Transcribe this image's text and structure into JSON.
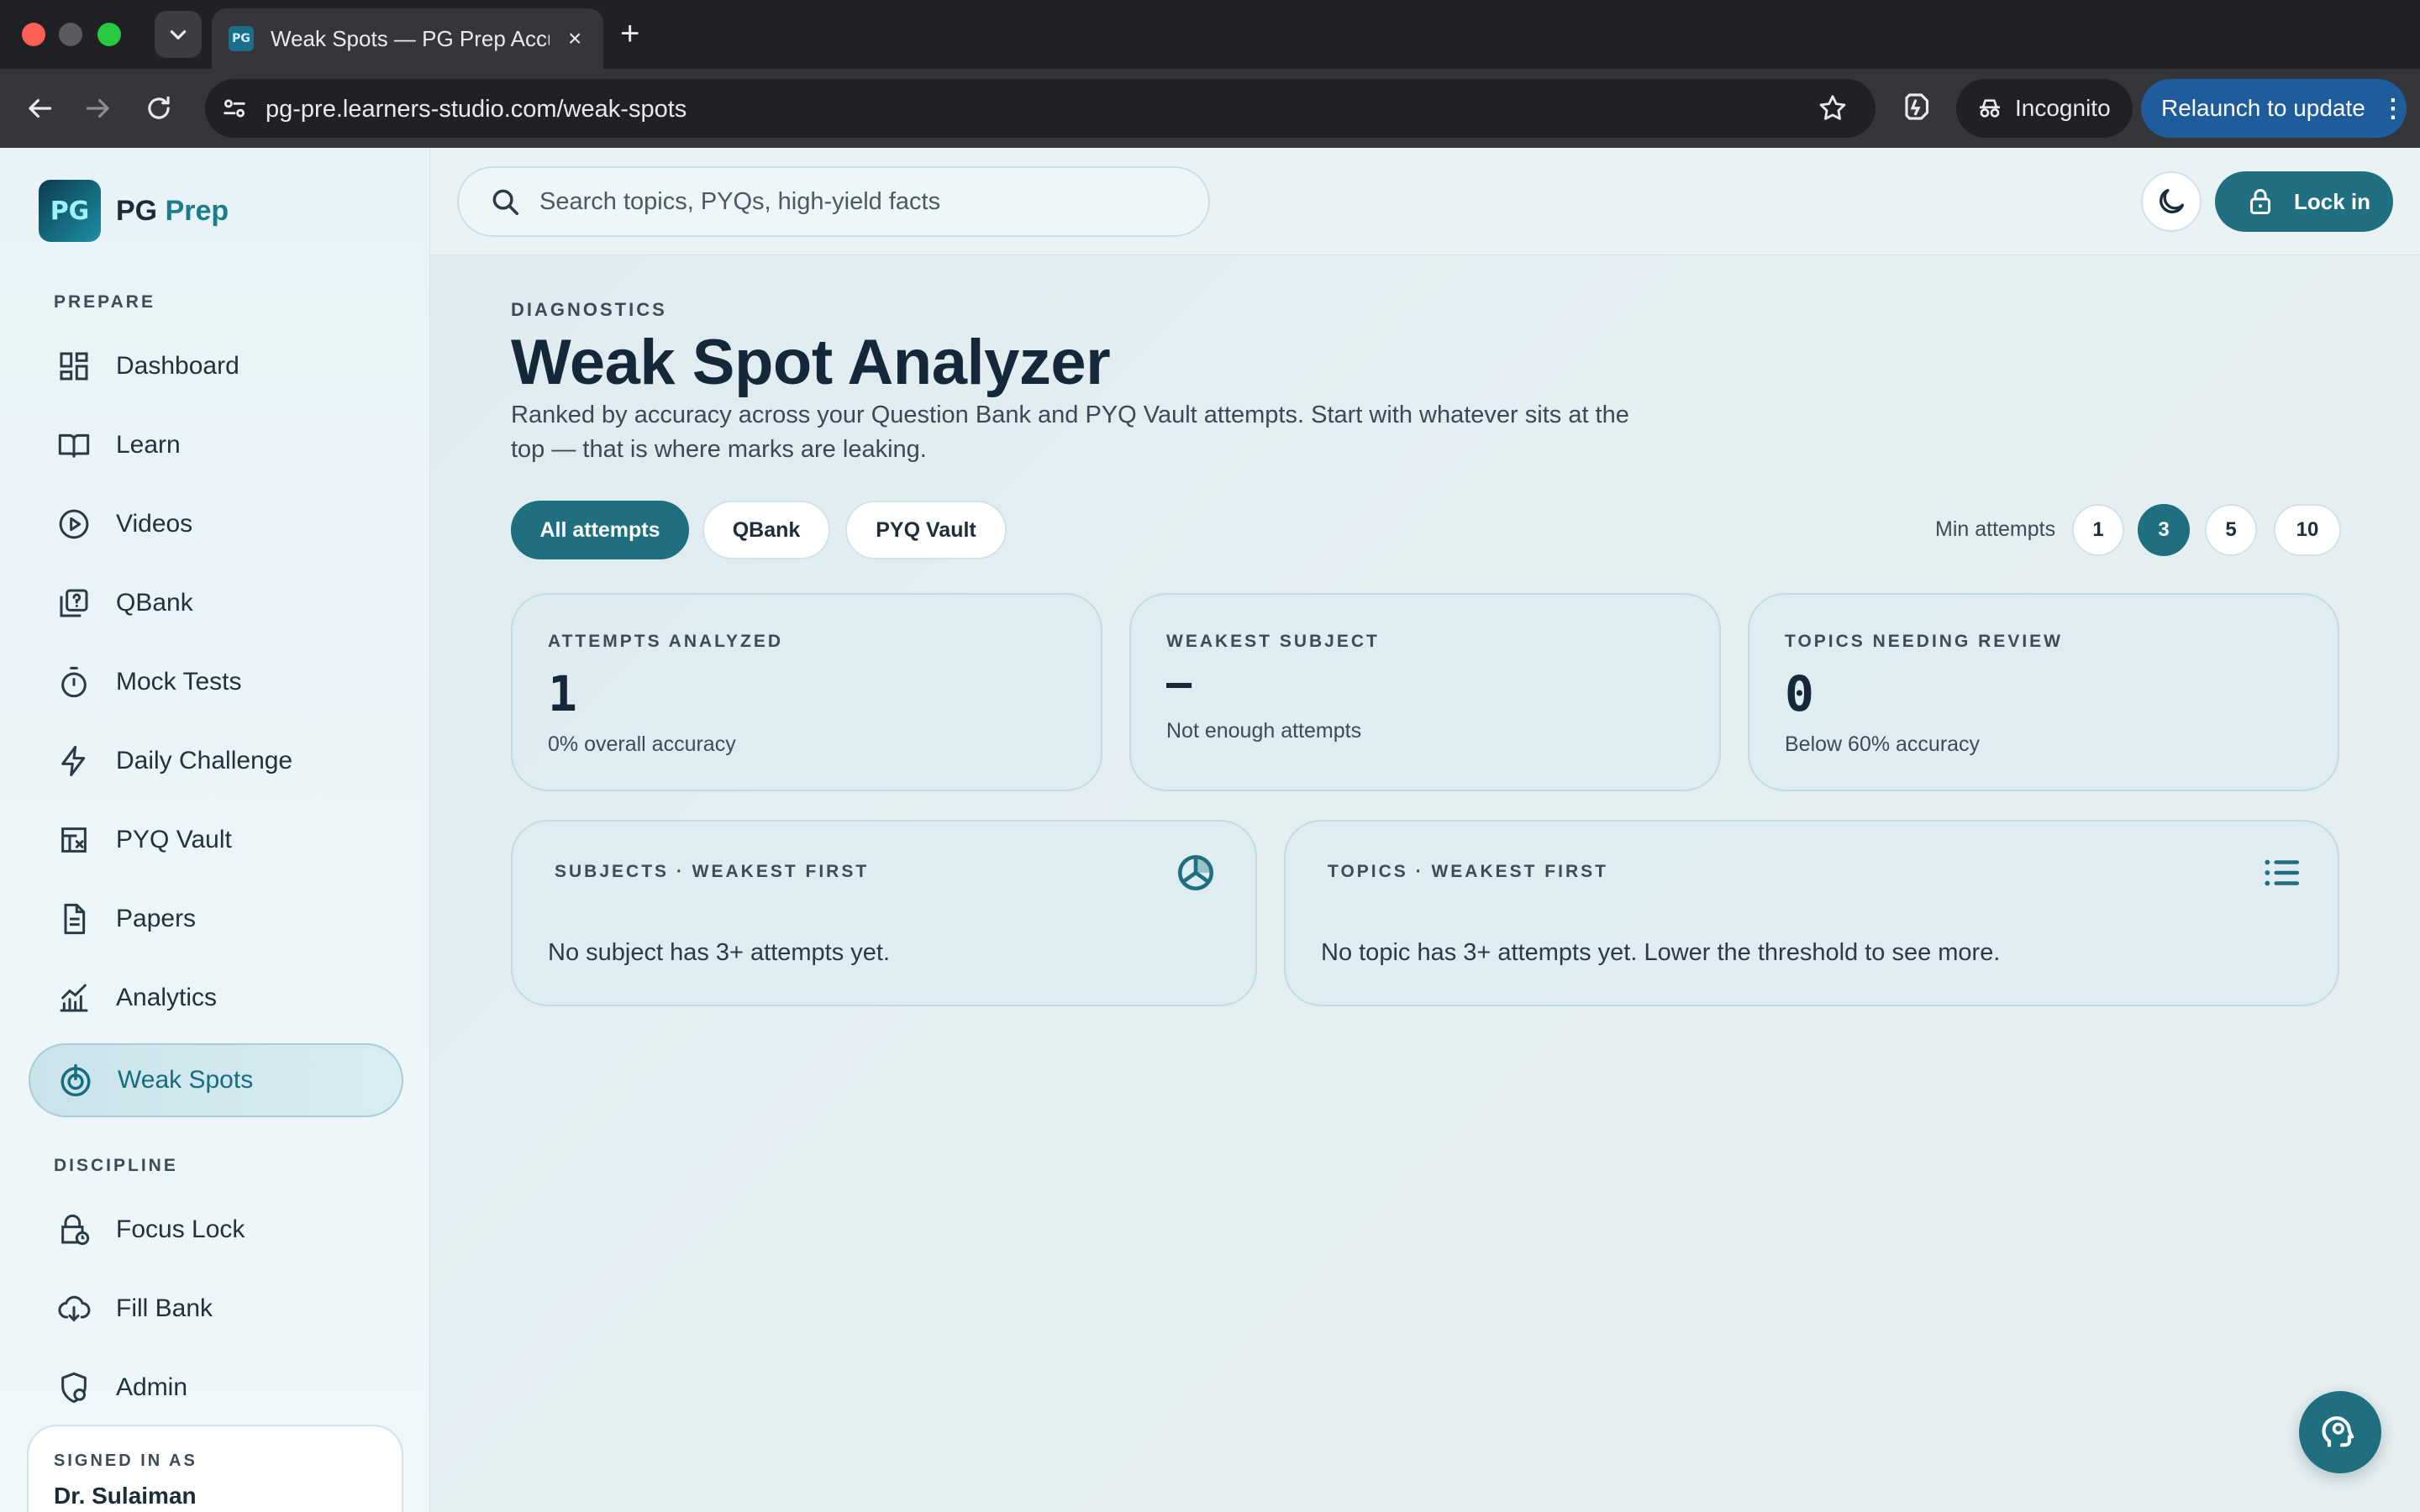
{
  "browser": {
    "tab_title": "Weak Spots — PG Prep Accur",
    "tab_close": "×",
    "new_tab": "+",
    "url": "pg-pre.learners-studio.com/weak-spots",
    "incognito_label": "Incognito",
    "relaunch_label": "Relaunch to update",
    "relaunch_menu": "⋮"
  },
  "brand": {
    "mark": "PG",
    "name_a": "PG",
    "name_b": "Prep"
  },
  "sidebar": {
    "prepare_label": "PREPARE",
    "prepare_items": [
      {
        "label": "Dashboard",
        "icon": "grid-icon"
      },
      {
        "label": "Learn",
        "icon": "book-icon"
      },
      {
        "label": "Videos",
        "icon": "play-icon"
      },
      {
        "label": "QBank",
        "icon": "question-bank-icon"
      },
      {
        "label": "Mock Tests",
        "icon": "stopwatch-icon"
      },
      {
        "label": "Daily Challenge",
        "icon": "lightning-icon"
      },
      {
        "label": "PYQ Vault",
        "icon": "vault-icon"
      },
      {
        "label": "Papers",
        "icon": "document-icon"
      },
      {
        "label": "Analytics",
        "icon": "chart-icon"
      },
      {
        "label": "Weak Spots",
        "icon": "target-icon",
        "active": true
      }
    ],
    "discipline_label": "DISCIPLINE",
    "discipline_items": [
      {
        "label": "Focus Lock",
        "icon": "lock-clock-icon"
      },
      {
        "label": "Fill Bank",
        "icon": "cloud-download-icon"
      },
      {
        "label": "Admin",
        "icon": "shield-gear-icon"
      }
    ],
    "signed_in_label": "SIGNED IN AS",
    "signed_in_name": "Dr. Sulaiman"
  },
  "topbar": {
    "search_placeholder": "Search topics, PYQs, high-yield facts",
    "lock_in_label": "Lock in"
  },
  "page": {
    "eyebrow": "DIAGNOSTICS",
    "title": "Weak Spot Analyzer",
    "description": "Ranked by accuracy across your Question Bank and PYQ Vault attempts. Start with whatever sits at the top — that is where marks are leaking.",
    "filters": [
      "All attempts",
      "QBank",
      "PYQ Vault"
    ],
    "active_filter": "All attempts",
    "min_attempts_label": "Min attempts",
    "min_attempts_options": [
      "1",
      "3",
      "5",
      "10"
    ],
    "min_attempts_selected": "3"
  },
  "stats": [
    {
      "label": "ATTEMPTS ANALYZED",
      "value": "1",
      "sub": "0% overall accuracy"
    },
    {
      "label": "WEAKEST SUBJECT",
      "value": "—",
      "sub": "Not enough attempts"
    },
    {
      "label": "TOPICS NEEDING REVIEW",
      "value": "0",
      "sub": "Below 60% accuracy"
    }
  ],
  "panels": {
    "subjects_label": "SUBJECTS · WEAKEST FIRST",
    "subjects_empty": "No subject has 3+ attempts yet.",
    "topics_label": "TOPICS · WEAKEST FIRST",
    "topics_empty": "No topic has 3+ attempts yet. Lower the threshold to see more."
  },
  "colors": {
    "accent": "#1f6f80",
    "active_nav_bg": "#d0e7ed",
    "sidebar_bg": "#eaf4f7"
  }
}
